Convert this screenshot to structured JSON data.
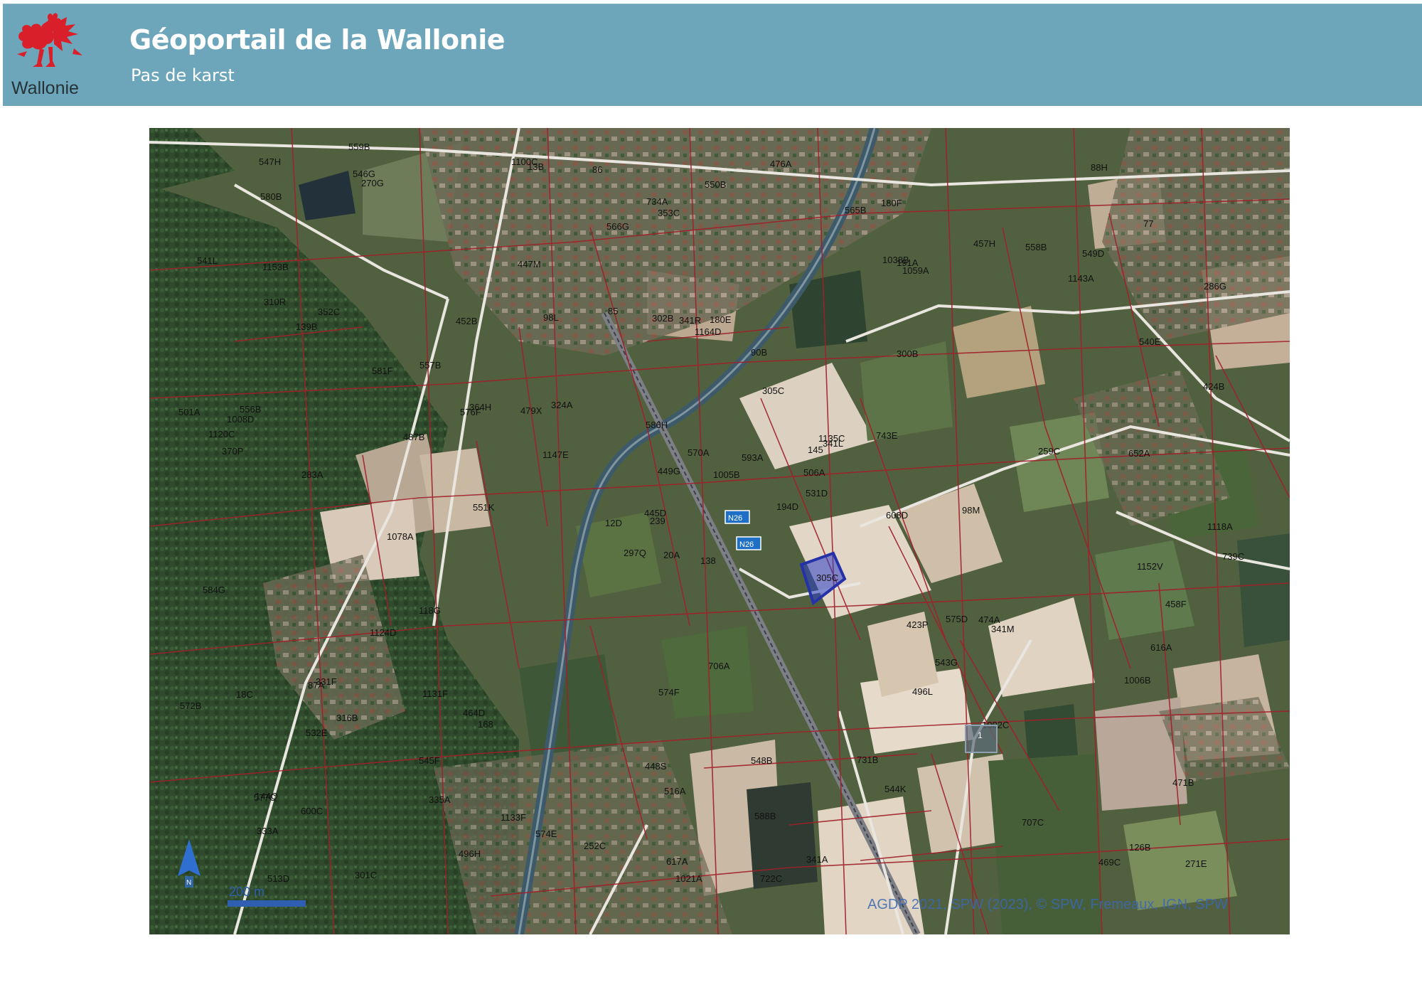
{
  "header": {
    "logo_text": "Wallonie",
    "title": "Géoportail de la Wallonie",
    "subtitle": "Pas de karst",
    "bg_color": "#6da6bb"
  },
  "map": {
    "scale_label": "200 m",
    "credit": "AGDP 2021, SPW (2023), © SPW, Fremeaux, IGN, SPW",
    "highlight_parcel": "305C",
    "icons": [
      "north-arrow-icon",
      "scale-bar",
      "marker-icon"
    ],
    "parcel_labels": [
      "138",
      "139B",
      "239",
      "144Q",
      "145",
      "168",
      "180F",
      "180E",
      "191A",
      "194D",
      "270G",
      "271E",
      "283A",
      "286G",
      "297Q",
      "300B",
      "301C",
      "302B",
      "305C",
      "316B",
      "324A",
      "333A",
      "335A",
      "341R",
      "341L",
      "341M",
      "352C",
      "353C",
      "370P",
      "423P",
      "424B",
      "445D",
      "448S",
      "449G",
      "452B",
      "457H",
      "464D",
      "469C",
      "471B",
      "474A",
      "476A",
      "479X",
      "487B",
      "496L",
      "496H",
      "501A",
      "506A",
      "513D",
      "516A",
      "531D",
      "532E",
      "540E",
      "541L",
      "543G",
      "544K",
      "545F",
      "546G",
      "547H",
      "548B",
      "549D",
      "550B",
      "551K",
      "556B",
      "557B",
      "558B",
      "559B",
      "565B",
      "566G",
      "570A",
      "572B",
      "574F",
      "574E",
      "575D",
      "576F",
      "577C",
      "580B",
      "581F",
      "584G",
      "586H",
      "588B",
      "593A",
      "600C",
      "608D",
      "616A",
      "617A",
      "652A",
      "706A",
      "707C",
      "722C",
      "731B",
      "734A",
      "739C",
      "743E",
      "1002C",
      "1005B",
      "1006B",
      "1008D",
      "1021A",
      "1038B",
      "1059A",
      "1078A",
      "1100C",
      "1118A",
      "1120C",
      "1124D",
      "1131F",
      "1133F",
      "1135C",
      "1143A",
      "1147E",
      "1152V",
      "1153B",
      "1164D",
      "12D",
      "13B",
      "18C",
      "20A",
      "77",
      "85",
      "86",
      "87A",
      "88H",
      "90B",
      "98L",
      "98M",
      "118G",
      "126B",
      "252C",
      "259C",
      "310R",
      "331F",
      "341A",
      "364H",
      "447M",
      "458F"
    ]
  }
}
